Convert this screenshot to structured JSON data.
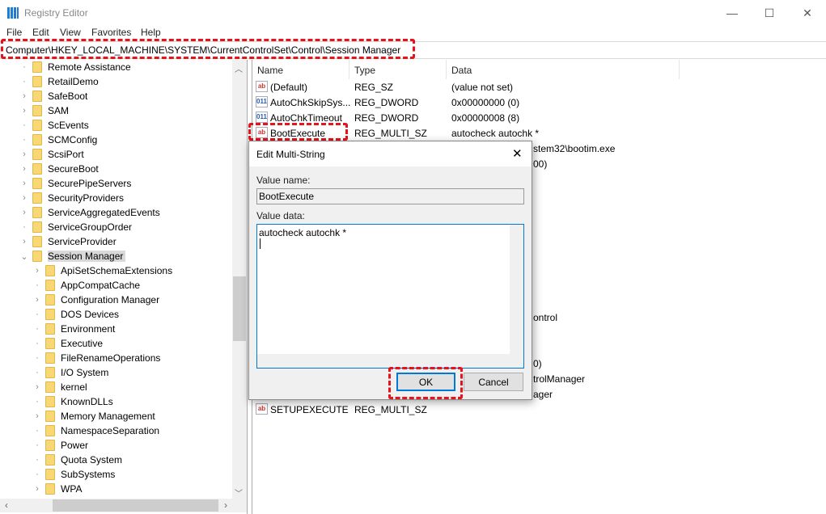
{
  "window": {
    "title": "Registry Editor",
    "minimize": "—",
    "maximize": "☐",
    "close": "✕"
  },
  "menu": [
    "File",
    "Edit",
    "View",
    "Favorites",
    "Help"
  ],
  "address": "Computer\\HKEY_LOCAL_MACHINE\\SYSTEM\\CurrentControlSet\\Control\\Session Manager",
  "tree": {
    "level1": [
      {
        "label": "Remote Assistance",
        "expandable": false
      },
      {
        "label": "RetailDemo",
        "expandable": false
      },
      {
        "label": "SafeBoot",
        "expandable": true
      },
      {
        "label": "SAM",
        "expandable": true
      },
      {
        "label": "ScEvents",
        "expandable": false
      },
      {
        "label": "SCMConfig",
        "expandable": false
      },
      {
        "label": "ScsiPort",
        "expandable": true
      },
      {
        "label": "SecureBoot",
        "expandable": true
      },
      {
        "label": "SecurePipeServers",
        "expandable": true
      },
      {
        "label": "SecurityProviders",
        "expandable": true
      },
      {
        "label": "ServiceAggregatedEvents",
        "expandable": true
      },
      {
        "label": "ServiceGroupOrder",
        "expandable": false
      },
      {
        "label": "ServiceProvider",
        "expandable": true
      },
      {
        "label": "Session Manager",
        "expandable": true,
        "expanded": true,
        "selected": true
      }
    ],
    "children": [
      {
        "label": "ApiSetSchemaExtensions",
        "expandable": true
      },
      {
        "label": "AppCompatCache",
        "expandable": false
      },
      {
        "label": "Configuration Manager",
        "expandable": true
      },
      {
        "label": "DOS Devices",
        "expandable": false
      },
      {
        "label": "Environment",
        "expandable": false
      },
      {
        "label": "Executive",
        "expandable": false
      },
      {
        "label": "FileRenameOperations",
        "expandable": false
      },
      {
        "label": "I/O System",
        "expandable": false
      },
      {
        "label": "kernel",
        "expandable": true
      },
      {
        "label": "KnownDLLs",
        "expandable": false
      },
      {
        "label": "Memory Management",
        "expandable": true
      },
      {
        "label": "NamespaceSeparation",
        "expandable": false
      },
      {
        "label": "Power",
        "expandable": false
      },
      {
        "label": "Quota System",
        "expandable": false
      },
      {
        "label": "SubSystems",
        "expandable": false
      },
      {
        "label": "WPA",
        "expandable": true
      }
    ]
  },
  "list": {
    "columns": [
      "Name",
      "Type",
      "Data"
    ],
    "rows": [
      {
        "icon": "ab",
        "name": "(Default)",
        "type": "REG_SZ",
        "data": "(value not set)",
        "index": 0
      },
      {
        "icon": "dword",
        "name": "AutoChkSkipSys...",
        "type": "REG_DWORD",
        "data": "0x00000000 (0)",
        "index": 1
      },
      {
        "icon": "dword",
        "name": "AutoChkTimeout",
        "type": "REG_DWORD",
        "data": "0x00000008 (8)",
        "index": 2
      },
      {
        "icon": "ab",
        "name": "BootExecute",
        "type": "REG_MULTI_SZ",
        "data": "autocheck autochk *",
        "index": 3
      },
      {
        "icon": "ab",
        "name": "SETUPEXECUTE",
        "type": "REG_MULTI_SZ",
        "data": "",
        "index": 21
      }
    ],
    "partial_data": [
      {
        "text": "stem32\\bootim.exe",
        "index": 4
      },
      {
        "text": "00)",
        "index": 5
      },
      {
        "text": "ontrol",
        "index": 15
      },
      {
        "text": "0)",
        "index": 18
      },
      {
        "text": "trolManager",
        "index": 19
      },
      {
        "text": "ager",
        "index": 20
      }
    ]
  },
  "dialog": {
    "title": "Edit Multi-String",
    "close": "✕",
    "value_name_label": "Value name:",
    "value_name": "BootExecute",
    "value_data_label": "Value data:",
    "value_data": "autocheck autochk *",
    "ok": "OK",
    "cancel": "Cancel"
  }
}
